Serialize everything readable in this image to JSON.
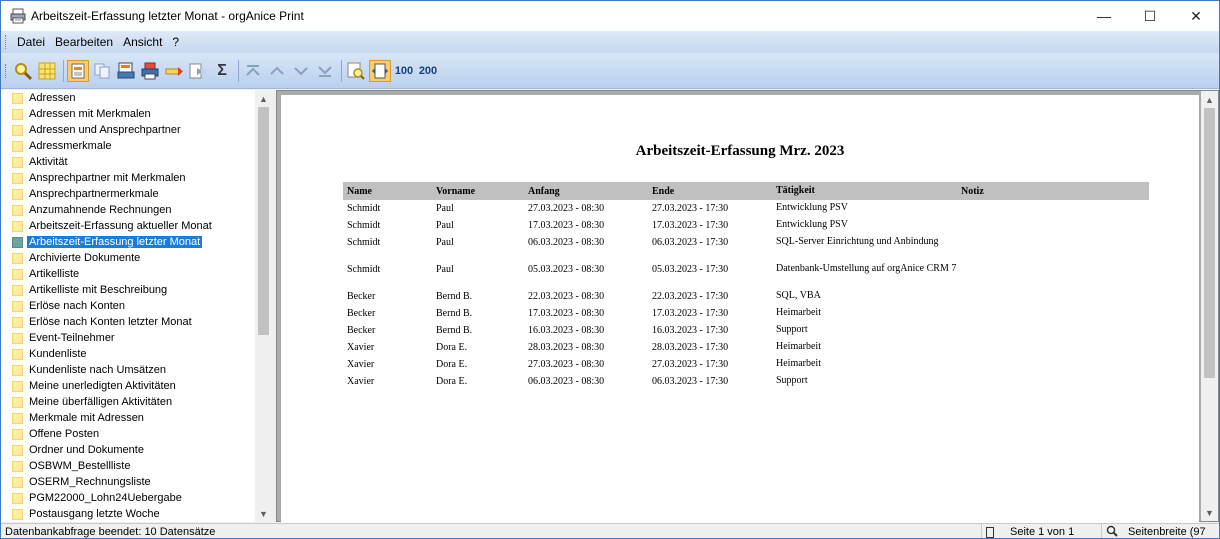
{
  "window": {
    "title": "Arbeitszeit-Erfassung letzter Monat - orgAnice Print",
    "minimize": "—",
    "maximize": "☐",
    "close": "✕"
  },
  "menu": {
    "items": [
      "Datei",
      "Bearbeiten",
      "Ansicht",
      "?"
    ]
  },
  "toolbar": {
    "zoom100_label": "100",
    "zoom200_label": "200"
  },
  "sidebar": {
    "items": [
      "Adressen",
      "Adressen mit Merkmalen",
      "Adressen und Ansprechpartner",
      "Adressmerkmale",
      "Aktivität",
      "Ansprechpartner mit Merkmalen",
      "Ansprechpartnermerkmale",
      "Anzumahnende Rechnungen",
      "Arbeitszeit-Erfassung aktueller Monat",
      "Arbeitszeit-Erfassung letzter Monat",
      "Archivierte Dokumente",
      "Artikelliste",
      "Artikelliste mit Beschreibung",
      "Erlöse nach Konten",
      "Erlöse nach Konten letzter Monat",
      "Event-Teilnehmer",
      "Kundenliste",
      "Kundenliste nach Umsätzen",
      "Meine unerledigten Aktivitäten",
      "Meine überfälligen Aktivitäten",
      "Merkmale mit Adressen",
      "Offene Posten",
      "Ordner und Dokumente",
      "OSBWM_Bestellliste",
      "OSERM_Rechnungsliste",
      "PGM22000_Lohn24Uebergabe",
      "Postausgang letzte Woche"
    ],
    "selected_index": 9
  },
  "report": {
    "title": "Arbeitszeit-Erfassung Mrz. 2023",
    "columns": [
      "Name",
      "Vorname",
      "Anfang",
      "Ende",
      "Tätigkeit",
      "Notiz"
    ],
    "rows": [
      [
        "Schmidt",
        "Paul",
        "27.03.2023 - 08:30",
        "27.03.2023 - 17:30",
        "Entwicklung PSV",
        ""
      ],
      [
        "Schmidt",
        "Paul",
        "17.03.2023 - 08:30",
        "17.03.2023 - 17:30",
        "Entwicklung PSV",
        ""
      ],
      [
        "Schmidt",
        "Paul",
        "06.03.2023 - 08:30",
        "06.03.2023 - 17:30",
        "SQL-Server Einrichtung und Anbindung",
        ""
      ],
      [
        "Schmidt",
        "Paul",
        "05.03.2023 - 08:30",
        "05.03.2023 - 17:30",
        "Datenbank-Umstellung auf orgAnice CRM 7",
        ""
      ],
      [
        "Becker",
        "Bernd B.",
        "22.03.2023 - 08:30",
        "22.03.2023 - 17:30",
        "SQL, VBA",
        ""
      ],
      [
        "Becker",
        "Bernd B.",
        "17.03.2023 - 08:30",
        "17.03.2023 - 17:30",
        "Heimarbeit",
        ""
      ],
      [
        "Becker",
        "Bernd B.",
        "16.03.2023 - 08:30",
        "16.03.2023 - 17:30",
        "Support",
        ""
      ],
      [
        "Xavier",
        "Dora E.",
        "28.03.2023 - 08:30",
        "28.03.2023 - 17:30",
        "Heimarbeit",
        ""
      ],
      [
        "Xavier",
        "Dora E.",
        "27.03.2023 - 08:30",
        "27.03.2023 - 17:30",
        "Heimarbeit",
        ""
      ],
      [
        "Xavier",
        "Dora E.",
        "06.03.2023 - 08:30",
        "06.03.2023 - 17:30",
        "Support",
        ""
      ]
    ]
  },
  "status": {
    "message": "Datenbankabfrage beendet: 10 Datensätze",
    "page_info": "Seite 1 von 1",
    "zoom_info": "Seitenbreite (97"
  }
}
